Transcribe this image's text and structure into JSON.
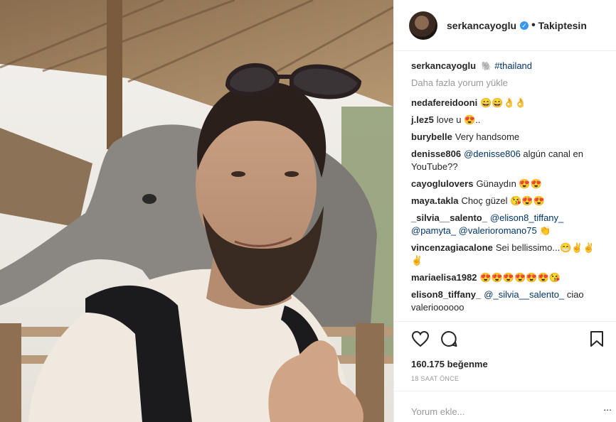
{
  "post": {
    "author": "serkancayoglu",
    "separator": "•",
    "follow_status": "Takiptesin"
  },
  "caption": {
    "user": "serkancayoglu",
    "emoji": "🐘",
    "hashtag": "#thailand"
  },
  "load_more": "Daha fazla yorum yükle",
  "comments": [
    {
      "user": "nedafereidooni",
      "text": "😄😄👌👌"
    },
    {
      "user": "j.lez5",
      "text": "love u 😍.."
    },
    {
      "user": "burybelle",
      "text": "Very handsome"
    },
    {
      "user": "denisse806",
      "mention": "@denisse806",
      "text": " algún canal en YouTube??"
    },
    {
      "user": "cayoglulovers",
      "text": "Günaydın 😍😍"
    },
    {
      "user": "maya.takla",
      "text": "Choç güzel 😘😍😍"
    },
    {
      "user": "_silvia__salento_",
      "mention": "@elison8_tiffany_ @pamyta_ @valerioromano75",
      "text": " 👏"
    },
    {
      "user": "vincenzagiacalone",
      "text": "Sei bellissimo...😁✌✌ ✌"
    },
    {
      "user": "mariaelisa1982",
      "text": "😍😍😍😍😍😍😘"
    },
    {
      "user": "elison8_tiffany_",
      "mention": "@_silvia__salento_",
      "text": " ciao valerioooooo"
    }
  ],
  "actions": {
    "like_icon": "heart-outline-icon",
    "comment_icon": "speech-bubble-icon",
    "save_icon": "bookmark-outline-icon"
  },
  "likes": "160.175 beğenme",
  "timestamp": "18 SAAT ÖNCE",
  "add_comment": {
    "placeholder": "Yorum ekle...",
    "more": "..."
  },
  "colors": {
    "link": "#003569",
    "verified": "#3897f0",
    "muted": "#999999",
    "border": "#efefef"
  }
}
